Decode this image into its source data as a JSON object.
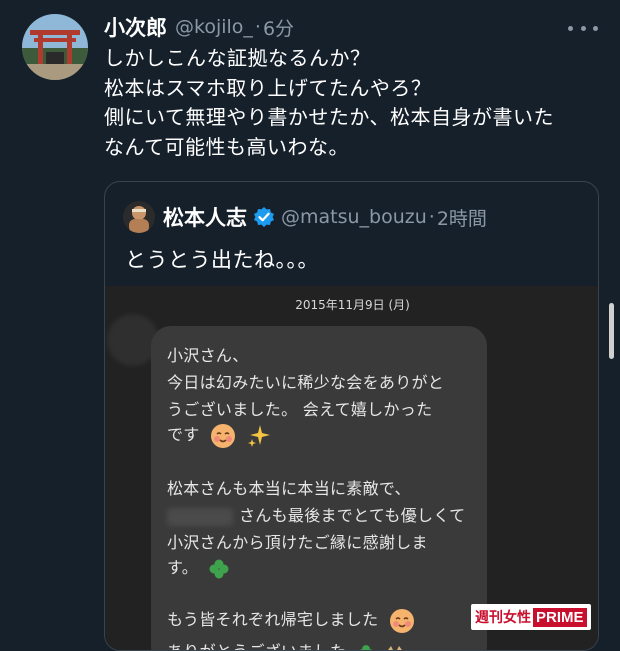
{
  "tweet": {
    "author_name": "小次郎",
    "handle": "@kojilo_",
    "separator": "·",
    "time": "6分",
    "lines": [
      "しかしこんな証拠なるんか？",
      "松本はスマホ取り上げてたんやろ？",
      "側にいて無理やり書かせたか、松本自身が書いた",
      "なんて可能性も高いわな。"
    ]
  },
  "quote": {
    "author_name": "松本人志",
    "handle": "@matsu_bouzu",
    "separator": "·",
    "time": "2時間",
    "text": "とうとう出たね。。。",
    "screenshot": {
      "date": "2015年11月9日 (月)",
      "message_lines": [
        "小沢さん、",
        "今日は幻みたいに稀少な会をありがと",
        "うございました。 会えて嬉しかった",
        "です",
        "",
        "松本さんも本当に本当に素敵で、",
        "さんも最後までとても優しくて",
        "小沢さんから頂けたご縁に感謝しま",
        "す。",
        "",
        "もう皆それぞれ帰宅しました",
        "ありがとうございました"
      ]
    }
  },
  "watermark": {
    "part1": "週刊女性",
    "part2": "PRIME"
  },
  "colors": {
    "background": "#15202b",
    "secondary_text": "#8b98a5",
    "verified": "#1d9bf0",
    "watermark_red": "#c8102e"
  },
  "icons": [
    "more-options-icon",
    "verified-badge-icon",
    "smiling-face-icon",
    "sparkles-icon",
    "clover-icon",
    "cat-icon"
  ]
}
